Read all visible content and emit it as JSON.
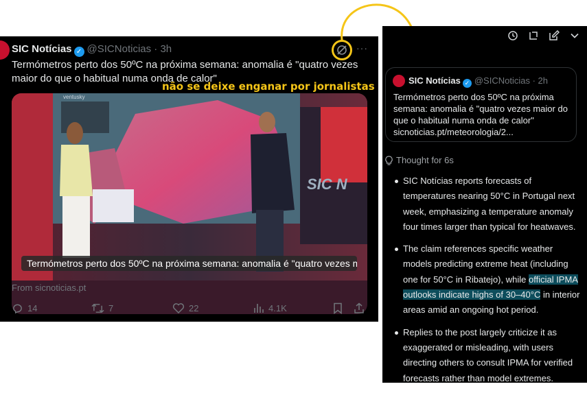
{
  "tweet": {
    "author_name": "SIC Notícias",
    "handle": "@SICNoticias",
    "age": "3h",
    "text": "Termómetros perto dos 50ºC na próxima semana: anomalia é \"quatro vezes maior do que o habitual numa onda de calor\"",
    "video_caption": "Termómetros perto dos 50ºC na próxima semana: anomalia é \"quatro vezes m...",
    "source": "From sicnoticias.pt",
    "replies": "14",
    "reposts": "7",
    "likes": "22",
    "views": "4.1K",
    "media_bg_text": "SIC N",
    "media_brand": "ventusky"
  },
  "annotation": {
    "overlay_text": "não se deixe enganar por jornalistas",
    "color": "#f5c518"
  },
  "grok_panel": {
    "quoted_post": {
      "author_name": "SIC Notícias",
      "handle": "@SICNoticias",
      "age": "2h",
      "text": "Termómetros perto dos 50ºC na próxima semana: anomalia é \"quatro vezes maior do que o habitual numa onda de calor\" sicnoticias.pt/meteorologia/2..."
    },
    "thought_label": "Thought for 6s",
    "bullets": [
      {
        "pre": "SIC Notícias reports forecasts of temperatures nearing 50°C in Portugal next week, emphasizing a temperature anomaly four times larger than typical for heatwaves.",
        "highlight": "",
        "post": ""
      },
      {
        "pre": "The claim references specific weather models predicting extreme heat (including one for 50°C in Ribatejo), while ",
        "highlight": "official IPMA outlooks indicate highs of 30–40°C",
        "post": " in interior areas amid an ongoing hot period."
      },
      {
        "pre": "Replies to the post largely criticize it as exaggerated or misleading, with users directing others to consult IPMA for verified forecasts rather than model extremes.",
        "highlight": "",
        "post": ""
      }
    ]
  },
  "colors": {
    "accent_blue": "#1d9bf0",
    "highlight": "#0d4d5c",
    "annotation_yellow": "#f5c518",
    "sic_red": "#c8102e"
  }
}
